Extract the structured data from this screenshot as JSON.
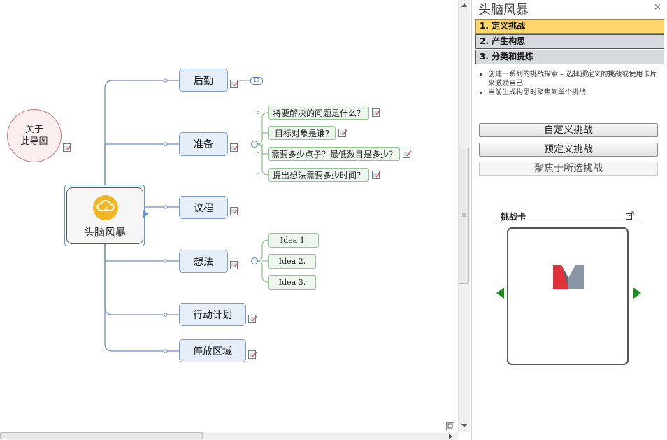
{
  "mindmap": {
    "central": "头脑风暴",
    "floating": "关于\n此导图",
    "branches": [
      {
        "label": "后勤",
        "badge": "17"
      },
      {
        "label": "准备"
      },
      {
        "label": "议程"
      },
      {
        "label": "想法"
      },
      {
        "label": "行动计划"
      },
      {
        "label": "停放区域"
      }
    ],
    "prep_subtopics": [
      "将要解决的问题是什么？",
      "目标对象是谁?",
      "需要多少点子？最低数目是多少？",
      "提出想法需要多少时间？"
    ],
    "idea_subtopics": [
      "Idea 1.",
      "Idea 2.",
      "Idea 3."
    ],
    "collapse_symbol": "−"
  },
  "pane": {
    "title": "头脑风暴",
    "close": "×",
    "steps": [
      "1. 定义挑战",
      "2. 产生构思",
      "3. 分类和提炼"
    ],
    "active_step": 0,
    "description": [
      "创建一系列的挑战探索 – 选择预定义的挑战或使用卡片来激励自己.",
      "当前生成构思时聚焦到单个挑战."
    ],
    "buttons": {
      "custom": "自定义挑战",
      "predefined": "预定义挑战",
      "focus": "聚焦于所选挑战"
    },
    "card_title": "挑战卡"
  },
  "colors": {
    "active_step": "#fcd66a",
    "card_arrow": "#1e8b1e",
    "topic_fill": "#e6eef9",
    "subtopic_fill": "#eef7ee",
    "central_logo": "#f1b623"
  }
}
